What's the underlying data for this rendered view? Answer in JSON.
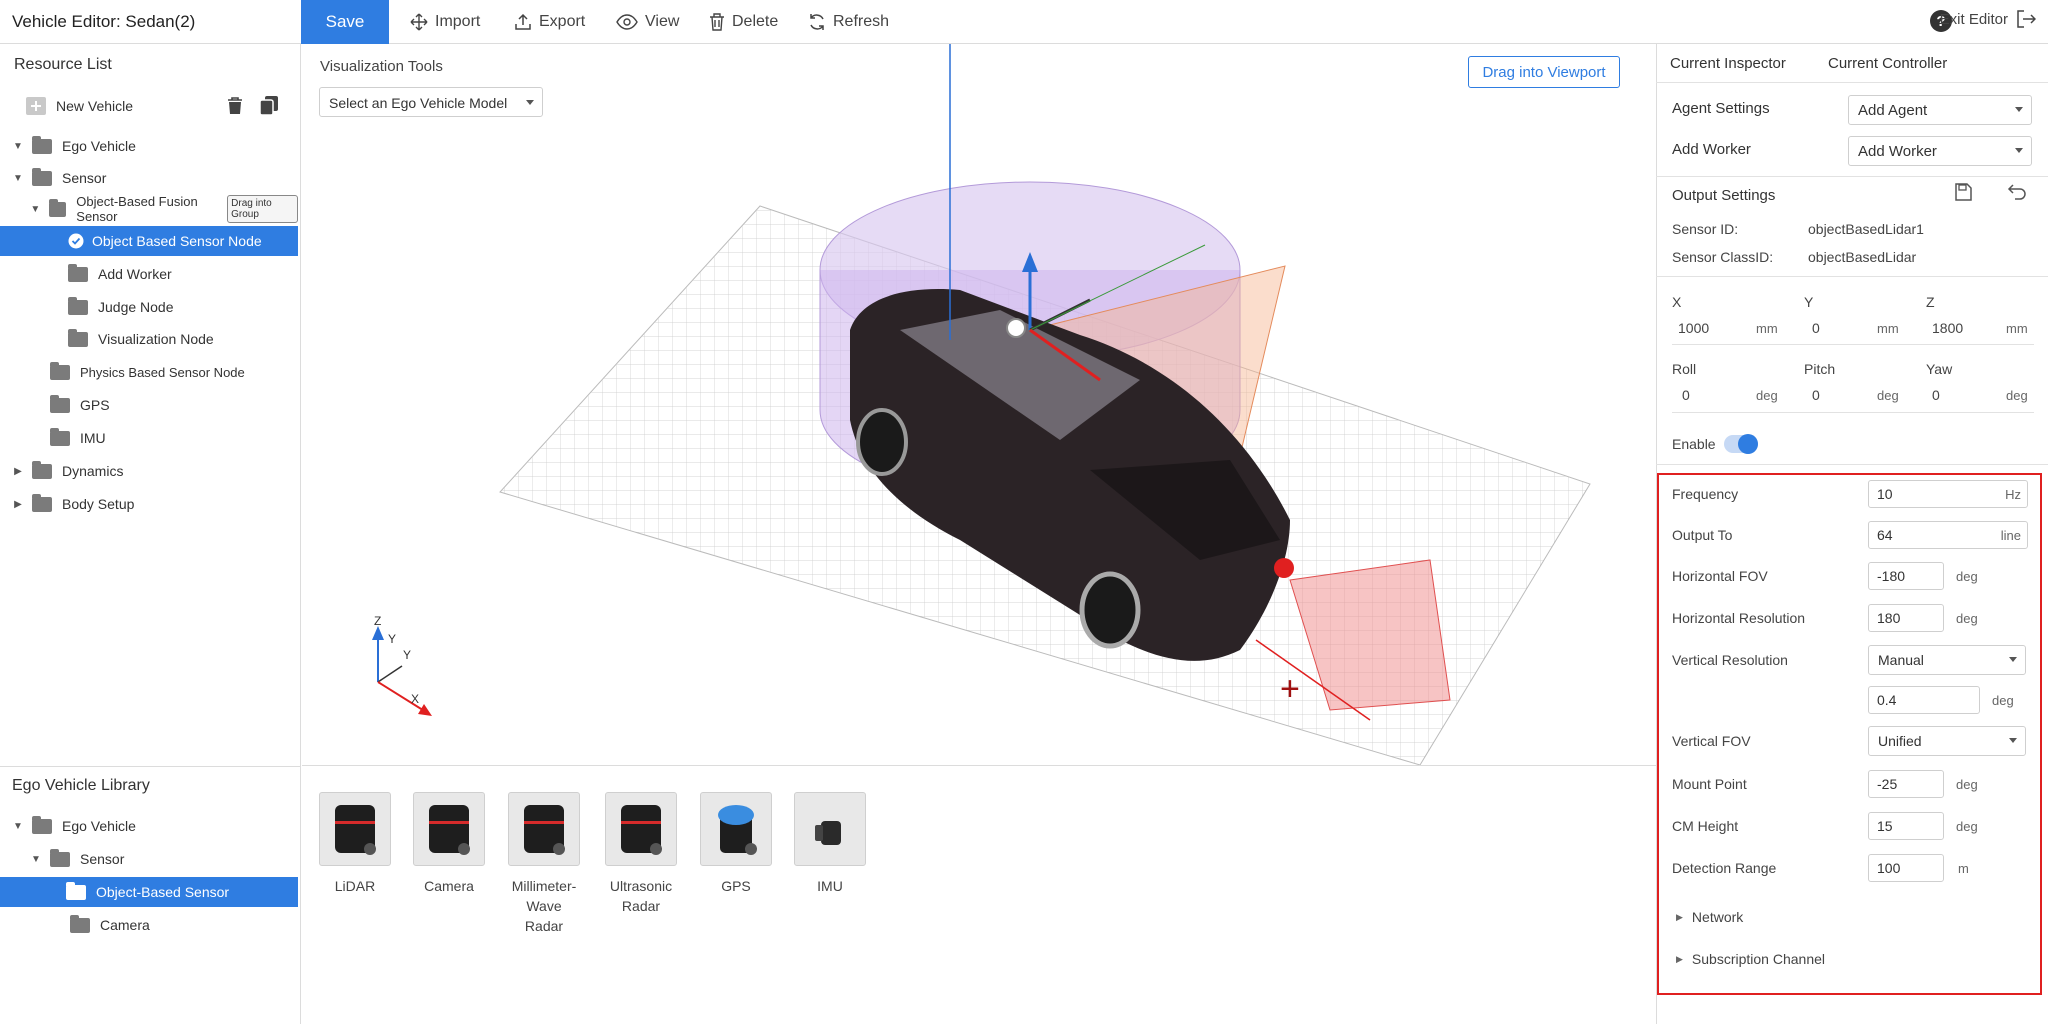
{
  "toolbar": {
    "title": "Vehicle Editor: Sedan(2)",
    "save": "Save",
    "import": "Import",
    "export": "Export",
    "view": "View",
    "delete": "Delete",
    "refresh": "Refresh",
    "exit": "Exit Editor"
  },
  "resource_list": {
    "title": "Resource List",
    "new_vehicle": "New Vehicle",
    "drag_into_group": "Drag into Group",
    "items": [
      {
        "label": "Ego Vehicle"
      },
      {
        "label": "Sensor"
      },
      {
        "label": "Object-Based Fusion Sensor"
      },
      {
        "label": "Object Based Sensor Node"
      },
      {
        "label": "Add Worker"
      },
      {
        "label": "Judge Node"
      },
      {
        "label": "Visualization Node"
      },
      {
        "label": "Physics Based Sensor Node"
      },
      {
        "label": "GPS"
      },
      {
        "label": "IMU"
      },
      {
        "label": "Dynamics"
      },
      {
        "label": "Body Setup"
      }
    ]
  },
  "library": {
    "title": "Ego Vehicle Library",
    "items": [
      {
        "label": "Ego Vehicle"
      },
      {
        "label": "Sensor"
      },
      {
        "label": "Object-Based Sensor"
      },
      {
        "label": "Camera"
      }
    ]
  },
  "viewport": {
    "tools_title": "Visualization Tools",
    "ego_select": "Select an Ego Vehicle Model",
    "drag_button": "Drag into Viewport",
    "axis_z": "Z",
    "axis_y": "Y",
    "axis_x": "X"
  },
  "palette": [
    {
      "line1": "LiDAR",
      "line2": ""
    },
    {
      "line1": "Camera",
      "line2": ""
    },
    {
      "line1": "Millimeter-Wave",
      "line2": "Radar"
    },
    {
      "line1": "Ultrasonic",
      "line2": "Radar"
    },
    {
      "line1": "GPS",
      "line2": ""
    },
    {
      "line1": "IMU",
      "line2": ""
    }
  ],
  "inspector": {
    "tab_inspector": "Current Inspector",
    "tab_controller": "Current Controller",
    "agent_settings": "Agent Settings",
    "agent_value": "Add Agent",
    "add_worker": "Add Worker",
    "worker_value": "Add Worker",
    "output_settings": "Output Settings",
    "sensor_id_label": "Sensor ID:",
    "sensor_id": "objectBasedLidar1",
    "sensor_class_label": "Sensor ClassID:",
    "sensor_class": "objectBasedLidar",
    "x_label": "X",
    "x_value": "1000",
    "x_unit": "mm",
    "y_label": "Y",
    "y_value": "0",
    "y_unit": "mm",
    "z_label": "Z",
    "z_value": "1800",
    "z_unit": "mm",
    "roll_label": "Roll",
    "roll_value": "0",
    "roll_unit": "deg",
    "pitch_label": "Pitch",
    "pitch_value": "0",
    "pitch_unit": "deg",
    "yaw_label": "Yaw",
    "yaw_value": "0",
    "yaw_unit": "deg",
    "enable_label": "Enable",
    "enabled": true,
    "frequency_label": "Frequency",
    "frequency": "10",
    "frequency_unit": "Hz",
    "output_to_label": "Output To",
    "output_to": "64",
    "output_to_unit": "line",
    "hfov_label": "Horizontal FOV",
    "hfov": "-180",
    "hfov_unit": "deg",
    "hres_label": "Horizontal Resolution",
    "hres": "180",
    "hres_unit": "deg",
    "vres_label": "Vertical Resolution",
    "vres_mode": "Manual",
    "vres": "0.4",
    "vres_unit": "deg",
    "vfov_label": "Vertical FOV",
    "vfov_mode": "Unified",
    "mount_label": "Mount Point",
    "mount": "-25",
    "mount_unit": "deg",
    "cm_label": "CM Height",
    "cm": "15",
    "cm_unit": "deg",
    "range_label": "Detection Range",
    "range": "100",
    "range_unit": "m",
    "network": "Network",
    "subscription": "Subscription Channel"
  },
  "colors": {
    "accent": "#2f7de1",
    "highlight_box": "#e02020"
  }
}
